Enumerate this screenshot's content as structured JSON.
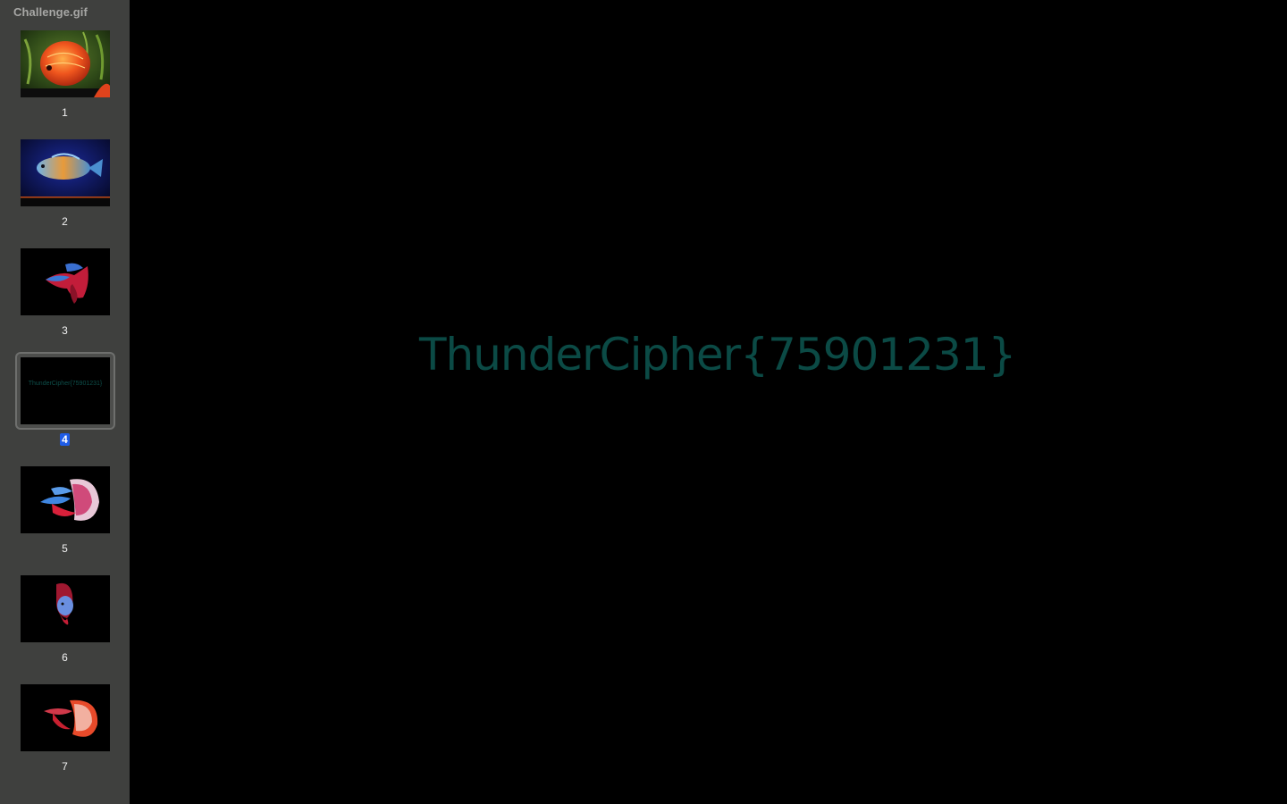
{
  "window": {
    "document_title": "Challenge.gif"
  },
  "sidebar": {
    "thumbnails": [
      {
        "page": "1",
        "icon": "discus-fish-image",
        "selected": false
      },
      {
        "page": "2",
        "icon": "oscar-fish-image",
        "selected": false
      },
      {
        "page": "3",
        "icon": "betta-fish-image",
        "selected": false
      },
      {
        "page": "4",
        "icon": "text-frame-image",
        "selected": true,
        "caption": "ThunderCipher{75901231}"
      },
      {
        "page": "5",
        "icon": "betta-fish-image",
        "selected": false
      },
      {
        "page": "6",
        "icon": "betta-fish-image",
        "selected": false
      },
      {
        "page": "7",
        "icon": "betta-fish-image",
        "selected": false
      }
    ]
  },
  "viewer": {
    "frame_text": "ThunderCipher{75901231}",
    "text_color": "#0b4a45",
    "background": "#000000"
  },
  "colors": {
    "sidebar_bg": "#3f403e",
    "selection_badge": "#1f5ce6"
  }
}
